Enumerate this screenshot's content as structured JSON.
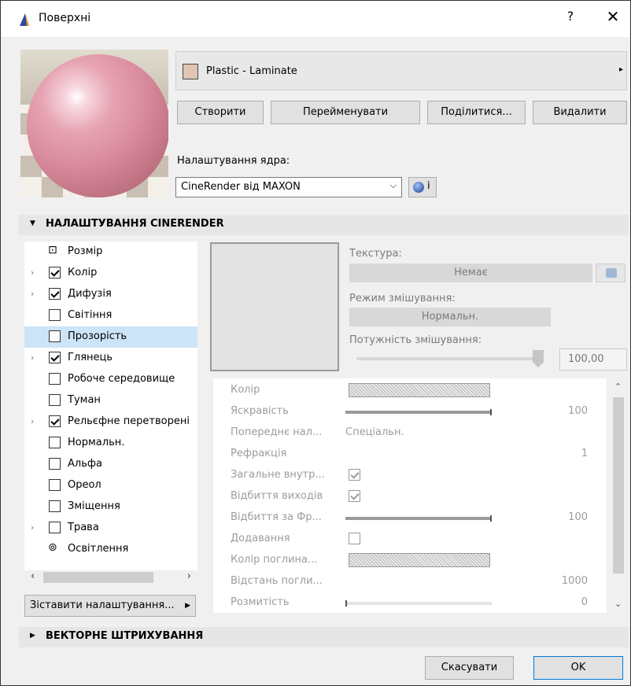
{
  "window": {
    "title": "Поверхні",
    "help": "?",
    "close": "✕"
  },
  "material": {
    "name": "Plastic - Laminate",
    "swatch_color": "#e1c6b3",
    "arrow": "▸"
  },
  "buttons": {
    "create": "Створити",
    "rename": "Перейменувати",
    "share": "Поділитися...",
    "delete": "Видалити"
  },
  "core": {
    "label": "Налаштування ядра:",
    "value": "CineRender від MAXON",
    "info": "i"
  },
  "sections": {
    "cinerender": "НАЛАШТУВАННЯ CINERENDER",
    "vector": "ВЕКТОРНЕ ШТРИХУВАННЯ"
  },
  "tree": [
    {
      "label": "Розмір",
      "type": "icon",
      "icon": "⊡",
      "expand": false,
      "checked": false
    },
    {
      "label": "Колір",
      "type": "check",
      "expand": true,
      "checked": true
    },
    {
      "label": "Дифузія",
      "type": "check",
      "expand": true,
      "checked": true
    },
    {
      "label": "Світіння",
      "type": "check",
      "expand": false,
      "checked": false
    },
    {
      "label": "Прозорість",
      "type": "check",
      "expand": false,
      "checked": false,
      "selected": true
    },
    {
      "label": "Глянець",
      "type": "check",
      "expand": true,
      "checked": true
    },
    {
      "label": "Робоче середовище",
      "type": "check",
      "expand": false,
      "checked": false
    },
    {
      "label": "Туман",
      "type": "check",
      "expand": false,
      "checked": false
    },
    {
      "label": "Рельєфне перетворені",
      "type": "check",
      "expand": true,
      "checked": true
    },
    {
      "label": "Нормальн.",
      "type": "check",
      "expand": false,
      "checked": false
    },
    {
      "label": "Альфа",
      "type": "check",
      "expand": false,
      "checked": false
    },
    {
      "label": "Ореол",
      "type": "check",
      "expand": false,
      "checked": false
    },
    {
      "label": "Зміщення",
      "type": "check",
      "expand": false,
      "checked": false
    },
    {
      "label": "Трава",
      "type": "check",
      "expand": true,
      "checked": false
    },
    {
      "label": "Освітлення",
      "type": "icon",
      "icon": "⊚",
      "expand": false,
      "checked": false
    }
  ],
  "match_button": "Зіставити налаштування...",
  "texture": {
    "label": "Текстура:",
    "value": "Немає",
    "blend_mode_label": "Режим змішування:",
    "blend_mode": "Нормальн.",
    "blend_strength_label": "Потужність змішування:",
    "blend_strength": "100,00",
    "blend_strength_level": 1.0
  },
  "params": [
    {
      "name": "Колір",
      "kind": "hatch"
    },
    {
      "name": "Яскравість",
      "kind": "bar",
      "level": 1.0,
      "value": "100"
    },
    {
      "name": "Попереднє нал...",
      "kind": "text",
      "text": "Спеціальн."
    },
    {
      "name": "Рефракція",
      "kind": "value",
      "value": "1"
    },
    {
      "name": "Загальне внутр...",
      "kind": "check",
      "checked": true
    },
    {
      "name": "Відбиття виходів",
      "kind": "check",
      "checked": true
    },
    {
      "name": "Відбиття за Фр...",
      "kind": "bar",
      "level": 1.0,
      "value": "100"
    },
    {
      "name": "Додавання",
      "kind": "check",
      "checked": false
    },
    {
      "name": "Колір поглина...",
      "kind": "hatch"
    },
    {
      "name": "Відстань погли...",
      "kind": "value",
      "value": "1000"
    },
    {
      "name": "Розмитість",
      "kind": "bar",
      "level": 0.0,
      "value": "0"
    }
  ],
  "footer": {
    "cancel": "Скасувати",
    "ok": "OK"
  }
}
